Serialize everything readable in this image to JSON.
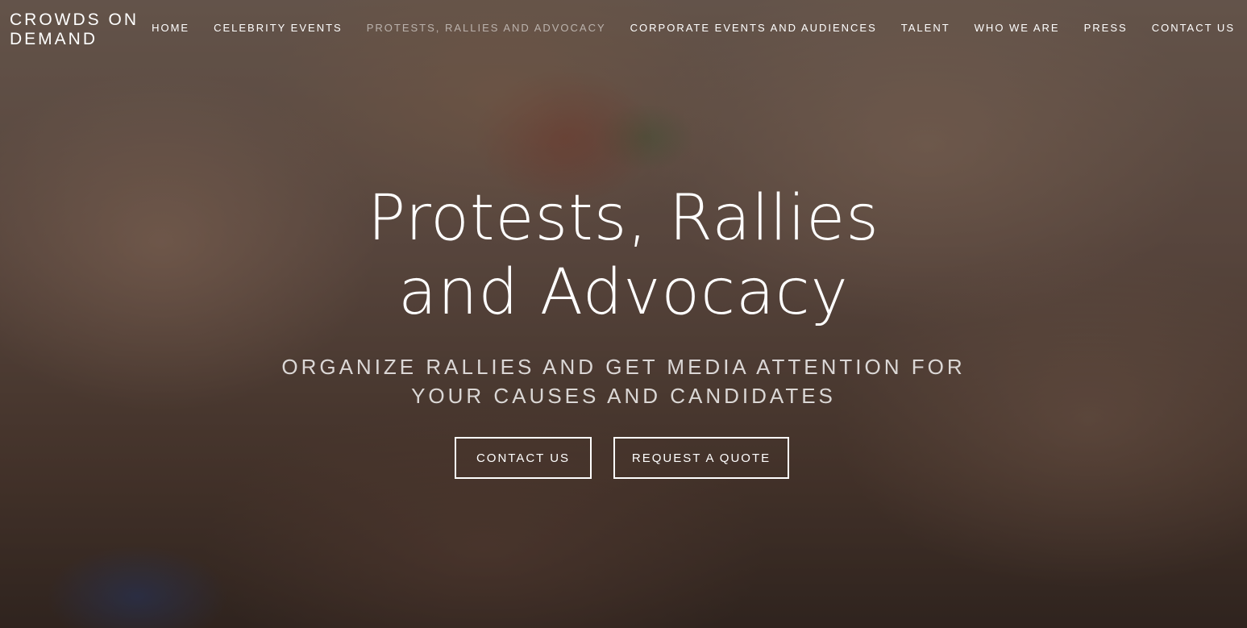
{
  "site": {
    "logo": "CROWDS ON DEMAND"
  },
  "nav": {
    "items": [
      {
        "label": "HOME"
      },
      {
        "label": "CELEBRITY EVENTS"
      },
      {
        "label": "PROTESTS, RALLIES AND ADVOCACY",
        "active": true
      },
      {
        "label": "CORPORATE EVENTS AND AUDIENCES"
      },
      {
        "label": "TALENT"
      },
      {
        "label": "WHO WE ARE"
      },
      {
        "label": "PRESS"
      },
      {
        "label": "CONTACT US"
      }
    ]
  },
  "hero": {
    "title": "Protests, Rallies and Advocacy",
    "subtitle": "ORGANIZE RALLIES AND GET MEDIA ATTENTION FOR YOUR CAUSES AND CANDIDATES",
    "buttons": {
      "contact": "CONTACT US",
      "quote": "REQUEST A QUOTE"
    }
  }
}
